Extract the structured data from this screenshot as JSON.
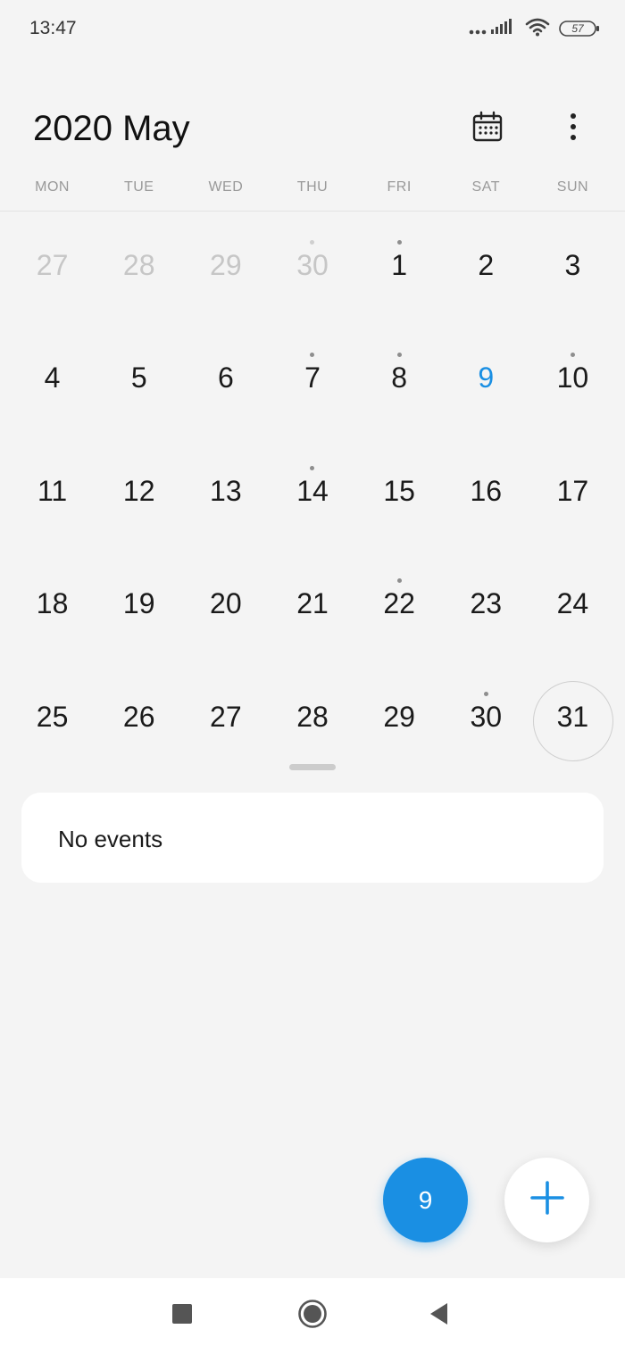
{
  "status_bar": {
    "time": "13:47",
    "battery": "57",
    "icons": [
      "signal-icon",
      "wifi-icon",
      "battery-icon"
    ]
  },
  "header": {
    "title": "2020 May",
    "icons": [
      "calendar-icon",
      "more-vert-icon"
    ]
  },
  "weekdays": [
    "MON",
    "TUE",
    "WED",
    "THU",
    "FRI",
    "SAT",
    "SUN"
  ],
  "days": [
    {
      "n": "27",
      "other": true,
      "dot": false
    },
    {
      "n": "28",
      "other": true,
      "dot": false
    },
    {
      "n": "29",
      "other": true,
      "dot": false
    },
    {
      "n": "30",
      "other": true,
      "dot": true
    },
    {
      "n": "1",
      "dot": true
    },
    {
      "n": "2",
      "dot": false
    },
    {
      "n": "3",
      "dot": false
    },
    {
      "n": "4",
      "dot": false
    },
    {
      "n": "5",
      "dot": false
    },
    {
      "n": "6",
      "dot": false
    },
    {
      "n": "7",
      "dot": true
    },
    {
      "n": "8",
      "dot": true
    },
    {
      "n": "9",
      "today": true,
      "dot": false
    },
    {
      "n": "10",
      "dot": true
    },
    {
      "n": "11",
      "dot": false
    },
    {
      "n": "12",
      "dot": false
    },
    {
      "n": "13",
      "dot": false
    },
    {
      "n": "14",
      "dot": true
    },
    {
      "n": "15",
      "dot": false
    },
    {
      "n": "16",
      "dot": false
    },
    {
      "n": "17",
      "dot": false
    },
    {
      "n": "18",
      "dot": false
    },
    {
      "n": "19",
      "dot": false
    },
    {
      "n": "20",
      "dot": false
    },
    {
      "n": "21",
      "dot": false
    },
    {
      "n": "22",
      "dot": true
    },
    {
      "n": "23",
      "dot": false
    },
    {
      "n": "24",
      "dot": false
    },
    {
      "n": "25",
      "dot": false
    },
    {
      "n": "26",
      "dot": false
    },
    {
      "n": "27",
      "dot": false
    },
    {
      "n": "28",
      "dot": false
    },
    {
      "n": "29",
      "dot": false
    },
    {
      "n": "30",
      "dot": true
    },
    {
      "n": "31",
      "selected": true,
      "dot": false
    }
  ],
  "events": {
    "empty_text": "No events"
  },
  "fab": {
    "today_label": "9",
    "add_icon": "plus-icon"
  },
  "nav": {
    "icons": [
      "recents-square-icon",
      "home-circle-icon",
      "back-triangle-icon"
    ]
  },
  "colors": {
    "accent": "#1a8fe3",
    "background": "#f4f4f4",
    "muted_text": "#c6c6c6"
  }
}
